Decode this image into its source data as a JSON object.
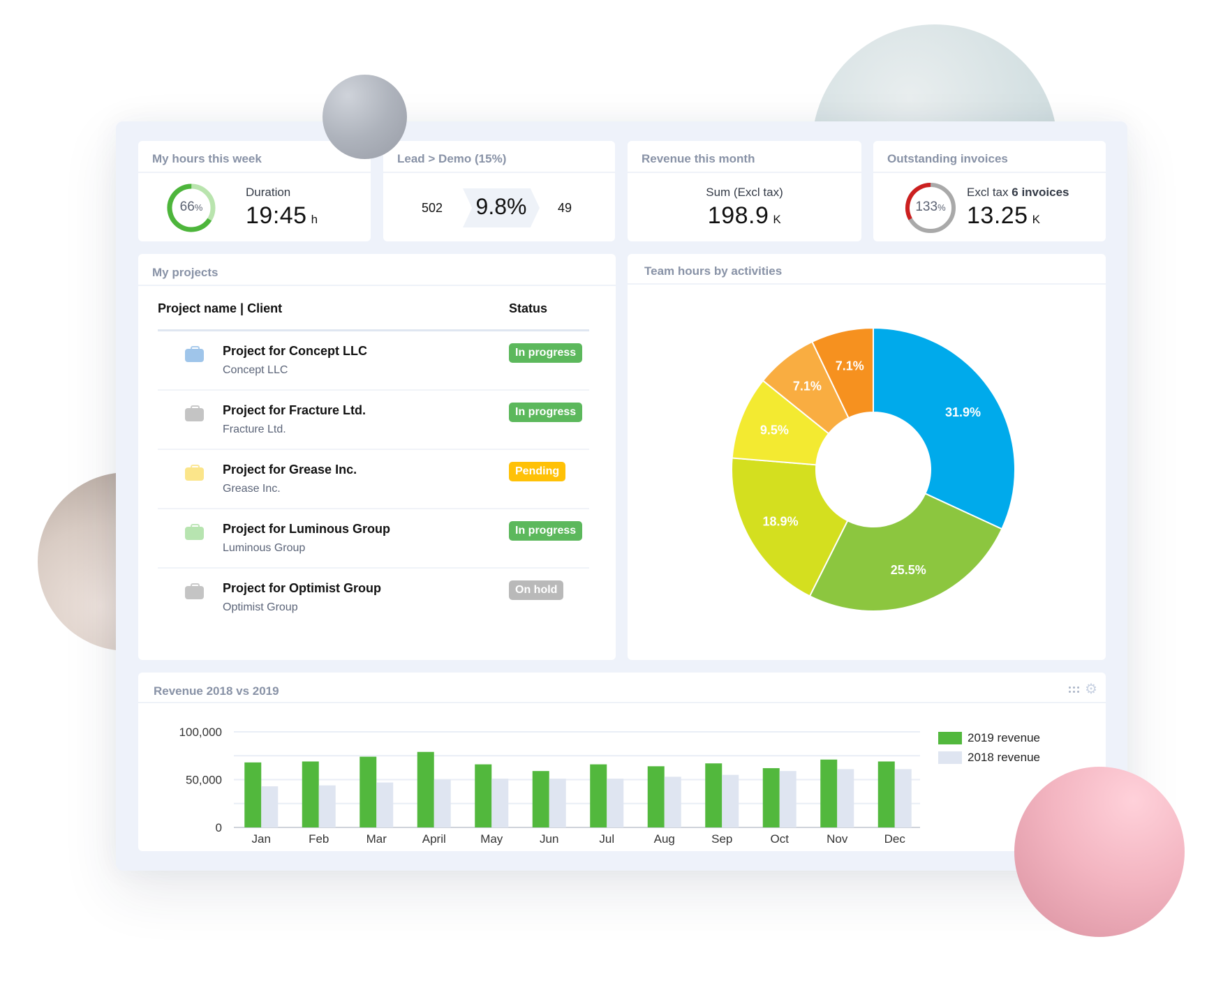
{
  "kpis": {
    "hours": {
      "title": "My hours this week",
      "ring_percent": 66,
      "ring_label": "66",
      "ring_label_unit": "%",
      "sub_label": "Duration",
      "value": "19:45",
      "unit": "h",
      "colors": {
        "progress": "#4db53b",
        "track": "#b9e4ae"
      }
    },
    "lead": {
      "title": "Lead > Demo (15%)",
      "left_value": "502",
      "center_value": "9.8%",
      "right_value": "49"
    },
    "revenue": {
      "title": "Revenue this month",
      "sub_label": "Sum (Excl tax)",
      "value": "198.9",
      "unit": "K"
    },
    "invoices": {
      "title": "Outstanding invoices",
      "ring_percent": 133,
      "ring_label": "133",
      "ring_label_unit": "%",
      "sub_label_prefix": "Excl tax",
      "sub_label_bold": "6 invoices",
      "value": "13.25",
      "unit": "K",
      "colors": {
        "overflow": "#cc1f1f",
        "track": "#a9a9a9"
      }
    }
  },
  "projects": {
    "title": "My projects",
    "columns": [
      "Project name | Client",
      "Status"
    ],
    "rows": [
      {
        "name": "Project for Concept LLC",
        "client": "Concept LLC",
        "status": "In progress",
        "icon_color": "#9fc5ea",
        "status_color": "#5cb85c"
      },
      {
        "name": "Project for Fracture Ltd.",
        "client": "Fracture Ltd.",
        "status": "In progress",
        "icon_color": "#c4c4c4",
        "status_color": "#5cb85c"
      },
      {
        "name": "Project for Grease Inc.",
        "client": "Grease Inc.",
        "status": "Pending",
        "icon_color": "#fbe58a",
        "status_color": "#ffc107"
      },
      {
        "name": "Project for Luminous Group",
        "client": "Luminous Group",
        "status": "In progress",
        "icon_color": "#b7e4b0",
        "status_color": "#5cb85c"
      },
      {
        "name": "Project for Optimist Group",
        "client": "Optimist Group",
        "status": "On hold",
        "icon_color": "#c4c4c4",
        "status_color": "#b9b9b9"
      }
    ]
  },
  "chart_data": [
    {
      "type": "pie",
      "title": "Team hours by activities",
      "donut": true,
      "start": "top, clockwise",
      "slices": [
        {
          "label": "31.9%",
          "value": 31.9,
          "color": "#00aaeb"
        },
        {
          "label": "25.5%",
          "value": 25.5,
          "color": "#8cc63f"
        },
        {
          "label": "18.9%",
          "value": 18.9,
          "color": "#d4df1f"
        },
        {
          "label": "9.5%",
          "value": 9.5,
          "color": "#f3ea31"
        },
        {
          "label": "7.1%",
          "value": 7.1,
          "color": "#f9ad41"
        },
        {
          "label": "7.1%",
          "value": 7.1,
          "color": "#f6911f"
        }
      ]
    },
    {
      "type": "bar",
      "title": "Revenue 2018 vs 2019",
      "categories": [
        "Jan",
        "Feb",
        "Mar",
        "April",
        "May",
        "Jun",
        "Jul",
        "Aug",
        "Sep",
        "Oct",
        "Nov",
        "Dec"
      ],
      "series": [
        {
          "name": "2019 revenue",
          "color": "#52b83d",
          "values": [
            68000,
            69000,
            74000,
            79000,
            66000,
            59000,
            66000,
            64000,
            67000,
            62000,
            71000,
            69000
          ]
        },
        {
          "name": "2018 revenue",
          "color": "#dfe5f1",
          "values": [
            43000,
            44000,
            47000,
            50000,
            51000,
            51000,
            51000,
            53000,
            55000,
            59000,
            61000,
            61000
          ]
        }
      ],
      "ylim": [
        0,
        100000
      ],
      "yticks": [
        {
          "value": 0,
          "label": "0"
        },
        {
          "value": 50000,
          "label": "50,000"
        },
        {
          "value": 100000,
          "label": "100,000"
        }
      ],
      "minor_gridlines": [
        25000,
        75000
      ],
      "grid": true,
      "legend": "right",
      "xlabel": "",
      "ylabel": ""
    }
  ],
  "revenue_card": {
    "title": "Revenue 2018 vs 2019",
    "tools": [
      "drag-handle-icon",
      "gear-icon"
    ]
  }
}
